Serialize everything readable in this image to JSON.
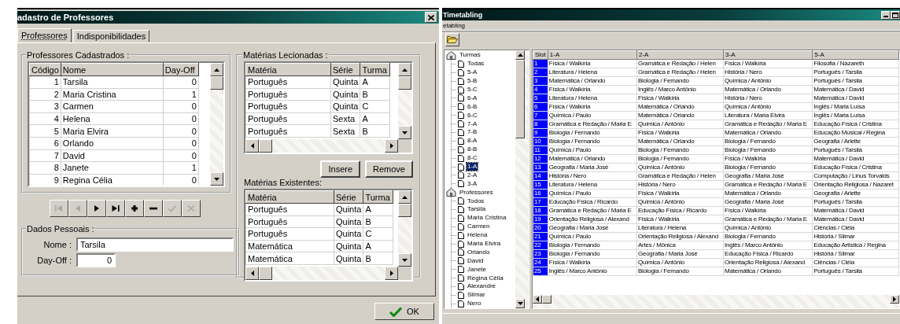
{
  "dialog": {
    "title": "adastro de Professores",
    "tabs": [
      {
        "label": "Professores",
        "selected": true
      },
      {
        "label": "Indisponibilidades",
        "selected": false
      }
    ],
    "professores": {
      "title": "Professores Cadastrados :",
      "columns": [
        "Código",
        "Nome",
        "Day-Off"
      ],
      "rows": [
        [
          "1",
          "Tarsila",
          "0"
        ],
        [
          "2",
          "Maria Cristina",
          "1"
        ],
        [
          "3",
          "Carmen",
          "0"
        ],
        [
          "4",
          "Helena",
          "0"
        ],
        [
          "5",
          "Maria Elvira",
          "0"
        ],
        [
          "6",
          "Orlando",
          "0"
        ],
        [
          "7",
          "David",
          "0"
        ],
        [
          "8",
          "Janete",
          "1"
        ],
        [
          "9",
          "Regina Célia",
          "0"
        ]
      ]
    },
    "nav_buttons": [
      {
        "kind": "first",
        "disabled": true
      },
      {
        "kind": "prior",
        "disabled": true
      },
      {
        "kind": "next",
        "disabled": false
      },
      {
        "kind": "last",
        "disabled": false
      },
      {
        "kind": "insert",
        "disabled": false
      },
      {
        "kind": "delete",
        "disabled": false
      },
      {
        "kind": "post",
        "disabled": true
      },
      {
        "kind": "cancel",
        "disabled": true
      }
    ],
    "dados_pessoais": {
      "title": "Dados Pessoais :",
      "fields": [
        {
          "kind": "text",
          "label": "Nome :",
          "value": "Tarsila"
        },
        {
          "kind": "number",
          "label": "Day-Off :",
          "value": "0"
        }
      ]
    },
    "materias_lecionadas": {
      "title": "Matérias Lecionadas :",
      "columns": [
        "Matéria",
        "Série",
        "Turma"
      ],
      "rows": [
        [
          "Português",
          "Quinta",
          "A"
        ],
        [
          "Português",
          "Quinta",
          "B"
        ],
        [
          "Português",
          "Quinta",
          "C"
        ],
        [
          "Português",
          "Sexta",
          "A"
        ],
        [
          "Português",
          "Sexta",
          "B"
        ]
      ]
    },
    "buttons": [
      "Insere",
      "Remove"
    ],
    "materias_existentes": {
      "title": "Matérias Existentes:",
      "columns": [
        "Matéria",
        "Série",
        "Turma"
      ],
      "rows": [
        [
          "Português",
          "Quinta",
          "A"
        ],
        [
          "Português",
          "Quinta",
          "B"
        ],
        [
          "Português",
          "Quinta",
          "C"
        ],
        [
          "Matemática",
          "Quinta",
          "A"
        ],
        [
          "Matemática",
          "Quinta",
          "B"
        ]
      ]
    },
    "ok_button": "OK"
  },
  "timetable": {
    "title": "Timetabling",
    "menu": [
      "etabling"
    ],
    "tree": [
      {
        "label": "Turmas",
        "selected": false,
        "children": [
          {
            "label": "Todas",
            "selected": false
          },
          {
            "label": "5-A",
            "selected": false
          },
          {
            "label": "5-B",
            "selected": false
          },
          {
            "label": "5-C",
            "selected": false
          },
          {
            "label": "6-A",
            "selected": false
          },
          {
            "label": "6-B",
            "selected": false
          },
          {
            "label": "6-C",
            "selected": false
          },
          {
            "label": "7-A",
            "selected": false
          },
          {
            "label": "7-B",
            "selected": false
          },
          {
            "label": "8-A",
            "selected": false
          },
          {
            "label": "8-B",
            "selected": false
          },
          {
            "label": "8-C",
            "selected": false
          },
          {
            "label": "1-A",
            "selected": true
          },
          {
            "label": "2-A",
            "selected": false
          },
          {
            "label": "3-A",
            "selected": false
          }
        ]
      },
      {
        "label": "Professores",
        "selected": false,
        "children": [
          {
            "label": "Todos",
            "selected": false
          },
          {
            "label": "Tarsila",
            "selected": false
          },
          {
            "label": "Maria Cristina",
            "selected": false
          },
          {
            "label": "Carmen",
            "selected": false
          },
          {
            "label": "Helena",
            "selected": false
          },
          {
            "label": "Maria Elvira",
            "selected": false
          },
          {
            "label": "Orlando",
            "selected": false
          },
          {
            "label": "David",
            "selected": false
          },
          {
            "label": "Janete",
            "selected": false
          },
          {
            "label": "Regina Célia",
            "selected": false
          },
          {
            "label": "Alexandre",
            "selected": false
          },
          {
            "label": "Silmar",
            "selected": false
          },
          {
            "label": "Nero",
            "selected": false
          }
        ]
      }
    ],
    "table": {
      "columns": [
        "Slot",
        "1-A",
        "2-A",
        "3-A",
        "5-A"
      ],
      "rows": [
        [
          "1",
          "Física / Walkíria",
          "Gramática e Redação / Helen",
          "Física / Walkíria",
          "Filosofia / Nazareth"
        ],
        [
          "2",
          "Literatura / Helena",
          "Gramática e Redação / Helen",
          "História / Nero",
          "Português / Tarsila"
        ],
        [
          "3",
          "Matemática / Orlando",
          "Biologia / Fernando",
          "Química / Antônio",
          "Português / Tarsila"
        ],
        [
          "4",
          "Física / Walkíria",
          "Inglês / Marco Antônio",
          "Matemática / Orlando",
          "Matemática / David"
        ],
        [
          "5",
          "Literatura / Helena",
          "Física / Walkíria",
          "História / Nero",
          "Matemática / David"
        ],
        [
          "6",
          "Física / Walkíria",
          "Matemática / Orlando",
          "Química / Antônio",
          "Inglês / Maria Luísa"
        ],
        [
          "7",
          "Química / Paulo",
          "Matemática / Orlando",
          "Literatura / Maria Elvira",
          "Inglês / Maria Luísa"
        ],
        [
          "8",
          "Gramática e Redação / Maria E",
          "Química / Antônio",
          "Gramática e Redação / Maria E",
          "Educação Física / Cristina"
        ],
        [
          "9",
          "Biologia / Fernando",
          "Física / Walkíria",
          "Matemática / Orlando",
          "Educação Musical / Regina"
        ],
        [
          "10",
          "Biologia / Fernando",
          "Matemática / Orlando",
          "Biologia / Fernando",
          "Geografia / Arlette"
        ],
        [
          "11",
          "Química / Paulo",
          "Biologia / Fernando",
          "Biologia / Fernando",
          "Português / Tarsila"
        ],
        [
          "12",
          "Matemática / Orlando",
          "Biologia / Fernando",
          "Física / Walkíria",
          "Matemática / David"
        ],
        [
          "13",
          "Geografia / Maria José",
          "Química / Antônio",
          "Biologia / Fernando",
          "Educação Física / Cristina"
        ],
        [
          "14",
          "História / Nero",
          "Gramática e Redação / Helen",
          "Geografia / Maria José",
          "Computação / Linus Torvalds"
        ],
        [
          "15",
          "Literatura / Helena",
          "História / Nero",
          "Gramática e Redação / Maria E",
          "Orientação Religiosa / Nazaret"
        ],
        [
          "16",
          "Química / Paulo",
          "Física / Walkíria",
          "Matemática / Orlando",
          "Geografia / Arlette"
        ],
        [
          "17",
          "Educação Física / Ricardo",
          "Química / Antônio",
          "Geografia / Maria José",
          "Português / Tarsila"
        ],
        [
          "18",
          "Gramática e Redação / Maria E",
          "Educação Física / Ricardo",
          "Física / Walkíria",
          "Matemática / David"
        ],
        [
          "19",
          "Orientação Religiosa / Alexand",
          "Física / Walkíria",
          "Gramática e Redação / Maria E",
          "Matemática / David"
        ],
        [
          "20",
          "Geografia / Maria José",
          "Literatura / Helena",
          "Química / Antônio",
          "Ciências / Cléia"
        ],
        [
          "21",
          "Química / Paulo",
          "Orientação Religiosa / Alexand",
          "Biologia / Fernando",
          "História / Silmar"
        ],
        [
          "22",
          "Biologia / Fernando",
          "Artes / Mônica",
          "Inglês / Marco Antônio",
          "Educação Artística / Regina"
        ],
        [
          "23",
          "Biologia / Fernando",
          "Geografia / Maria José",
          "Educação Física / Ricardo",
          "História / Silmar"
        ],
        [
          "24",
          "Física / Walkíria",
          "Química / Antônio",
          "Orientação Religiosa / Alexand",
          "Ciências / Cléia"
        ],
        [
          "25",
          "Inglês / Marco Antônio",
          "Biologia / Fernando",
          "Matemática / Orlando",
          "Português / Tarsila"
        ]
      ]
    }
  }
}
